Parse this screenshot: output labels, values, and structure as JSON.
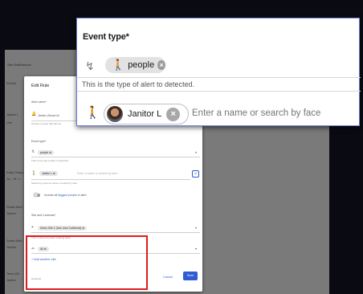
{
  "background": {
    "header": "Site Notifications",
    "rows": [
      "Events",
      "Janitor L",
      "Unu",
      "Entry Team (Ja",
      "Ja...  W...L",
      "Smart Alert",
      "Janitor",
      "Janitor",
      "Smart Alert",
      "Janitor",
      "Smart Alert",
      "Janitor",
      "Team (Dr",
      "Janitor"
    ]
  },
  "dialog": {
    "title": "Edit Rule",
    "alert_name_label": "Alert name*",
    "alert_name_value": "Janitor (Smart Al",
    "alert_name_hint": "Choose a name that will me",
    "event_type_label": "Event type*",
    "event_chip": "people",
    "event_hint": "This is the type of alert to detected.",
    "person_chip": "Janitor L",
    "person_placeholder": "Enter a name or search by face",
    "person_hint": "Search by persons name or search by face",
    "toggle_label_prefix": "Include all ",
    "toggle_label_link": "flagged people",
    "toggle_label_suffix": " in alert",
    "sites_label": "Site and Cameras*",
    "site_chip": "Demo Site 1 (San Jose California)",
    "site_hint": "This is where the alert is taking place",
    "camera_chip": "All",
    "add_site": "+ Add another site",
    "required": "Required",
    "cancel": "Cancel",
    "save": "Save"
  },
  "zoom": {
    "title": "Event type*",
    "event_chip": "people",
    "hint": "This is the type of alert to detected.",
    "person_chip": "Janitor L",
    "person_placeholder": "Enter a name or search by face"
  },
  "colors": {
    "accent": "#2f5bd3",
    "highlight": "#e01b1b"
  }
}
